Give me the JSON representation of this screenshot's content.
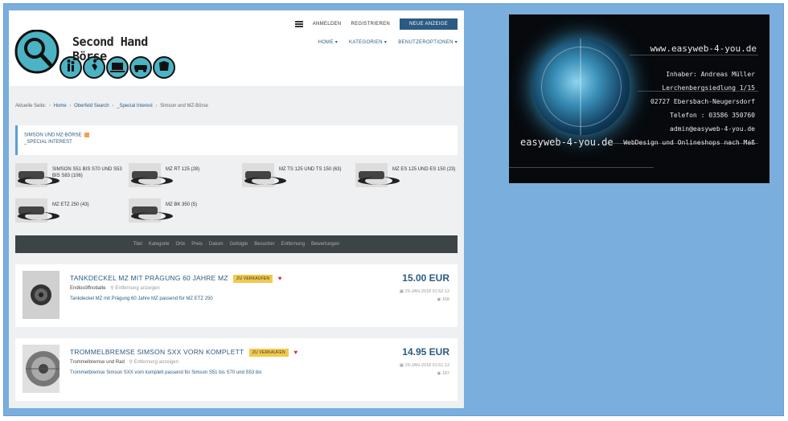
{
  "header": {
    "logo_text": "Second Hand Börse",
    "topnav": {
      "login": "ANMELDEN",
      "register": "REGISTRIEREN",
      "new_ad": "NEUE ANZEIGE"
    },
    "mainnav": [
      "HOME",
      "KATEGORIEN",
      "BENUTZEROPTIONEN"
    ]
  },
  "breadcrumb": {
    "current_label": "Aktuelle Seite:",
    "items": [
      "Home",
      "Oberfeld Search",
      "_Special Interest",
      "Simson und MZ-Börse"
    ]
  },
  "category": {
    "title": "SIMSON UND MZ-BÖRSE",
    "parent": "_SPECIAL INTEREST"
  },
  "subcategories": [
    {
      "label": "SIMSON S51 BIS S70 UND S53 BIS S83 (106)"
    },
    {
      "label": "MZ RT 125 (28)"
    },
    {
      "label": "MZ TS 125 UND TS 150 (63)"
    },
    {
      "label": "MZ ES 125 UND ES 150 (23)"
    },
    {
      "label": "MZ ETZ 250 (43)"
    },
    {
      "label": "MZ BK 350 (5)"
    }
  ],
  "filters": [
    "Titel",
    "Kategorie",
    "Orte",
    "Preis",
    "Datum",
    "Gefolgte",
    "Besucher",
    "Entfernung",
    "Bewertungen"
  ],
  "listings": [
    {
      "title": "TANKDECKEL MZ MIT PRÄGUNG 60 JAHRE MZ",
      "badge": "ZU VERKAUFEN",
      "seller": "Endlosöffnobalte",
      "location": "Entfernung anzeigen",
      "desc": "Tankdeckel MZ mit Prägung 60 Jahre MZ passend für MZ ETZ 250",
      "price": "15.00 EUR",
      "date": "29-JAN-2018 01:52:12",
      "views": "168"
    },
    {
      "title": "TROMMELBREMSE SIMSON SXX VORN KOMPLETT",
      "badge": "ZU VERKAUFEN",
      "seller": "Trommelbremse und Rad",
      "location": "Entfernung anzeigen",
      "desc": "Trommelbremse Simson SXX vorn komplett passend für Simson S51 bis S70 und S53 bis",
      "price": "14.95 EUR",
      "date": "29-JAN-2018 01:51:12",
      "views": "187"
    }
  ],
  "ad": {
    "url_top": "www.easyweb-4-you.de",
    "url_left": "easyweb-4-you.de",
    "lines": [
      "Inhaber: Andreas Müller",
      "Lerchenbergsiedlung 1/15",
      "02727 Ebersbach-Neugersdorf",
      "Telefon : 03586 350760",
      "admin@easyweb-4-you.de",
      "WebDesign und Onlineshops nach Maß"
    ]
  }
}
